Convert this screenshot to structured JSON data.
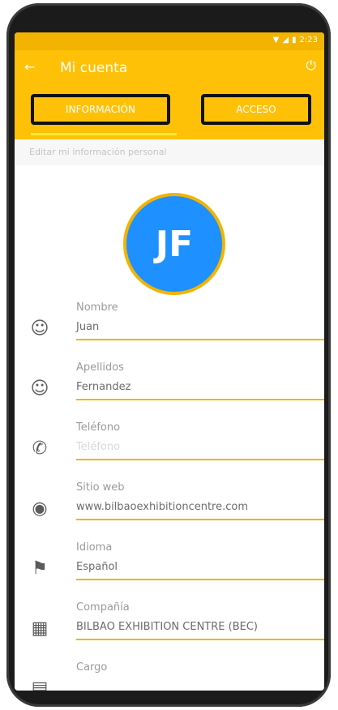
{
  "statusbar": {
    "time": "2:23"
  },
  "header": {
    "title": "Mi cuenta"
  },
  "tabs": [
    {
      "label": "INFORMACIÓN"
    },
    {
      "label": "ACCESO"
    }
  ],
  "subtitle": "Editar mi información personal",
  "avatar": {
    "initials": "JF"
  },
  "fields": [
    {
      "label": "Nombre",
      "value": "Juan",
      "icon": "person-icon"
    },
    {
      "label": "Apellidos",
      "value": "Fernandez",
      "icon": "person-icon"
    },
    {
      "label": "Teléfono",
      "placeholder": "Teléfono",
      "icon": "phone-icon"
    },
    {
      "label": "Sitio web",
      "value": "www.bilbaoexhibitioncentre.com",
      "icon": "globe-icon"
    },
    {
      "label": "Idioma",
      "value": "Español",
      "icon": "flag-icon"
    },
    {
      "label": "Compañía",
      "value": "BILBAO EXHIBITION CENTRE (BEC)",
      "icon": "building-icon"
    },
    {
      "label": "Cargo",
      "icon": "badge-icon"
    }
  ],
  "colors": {
    "accent": "#ffc107",
    "statusbar": "#f2b400",
    "avatar": "#1e90ff"
  }
}
